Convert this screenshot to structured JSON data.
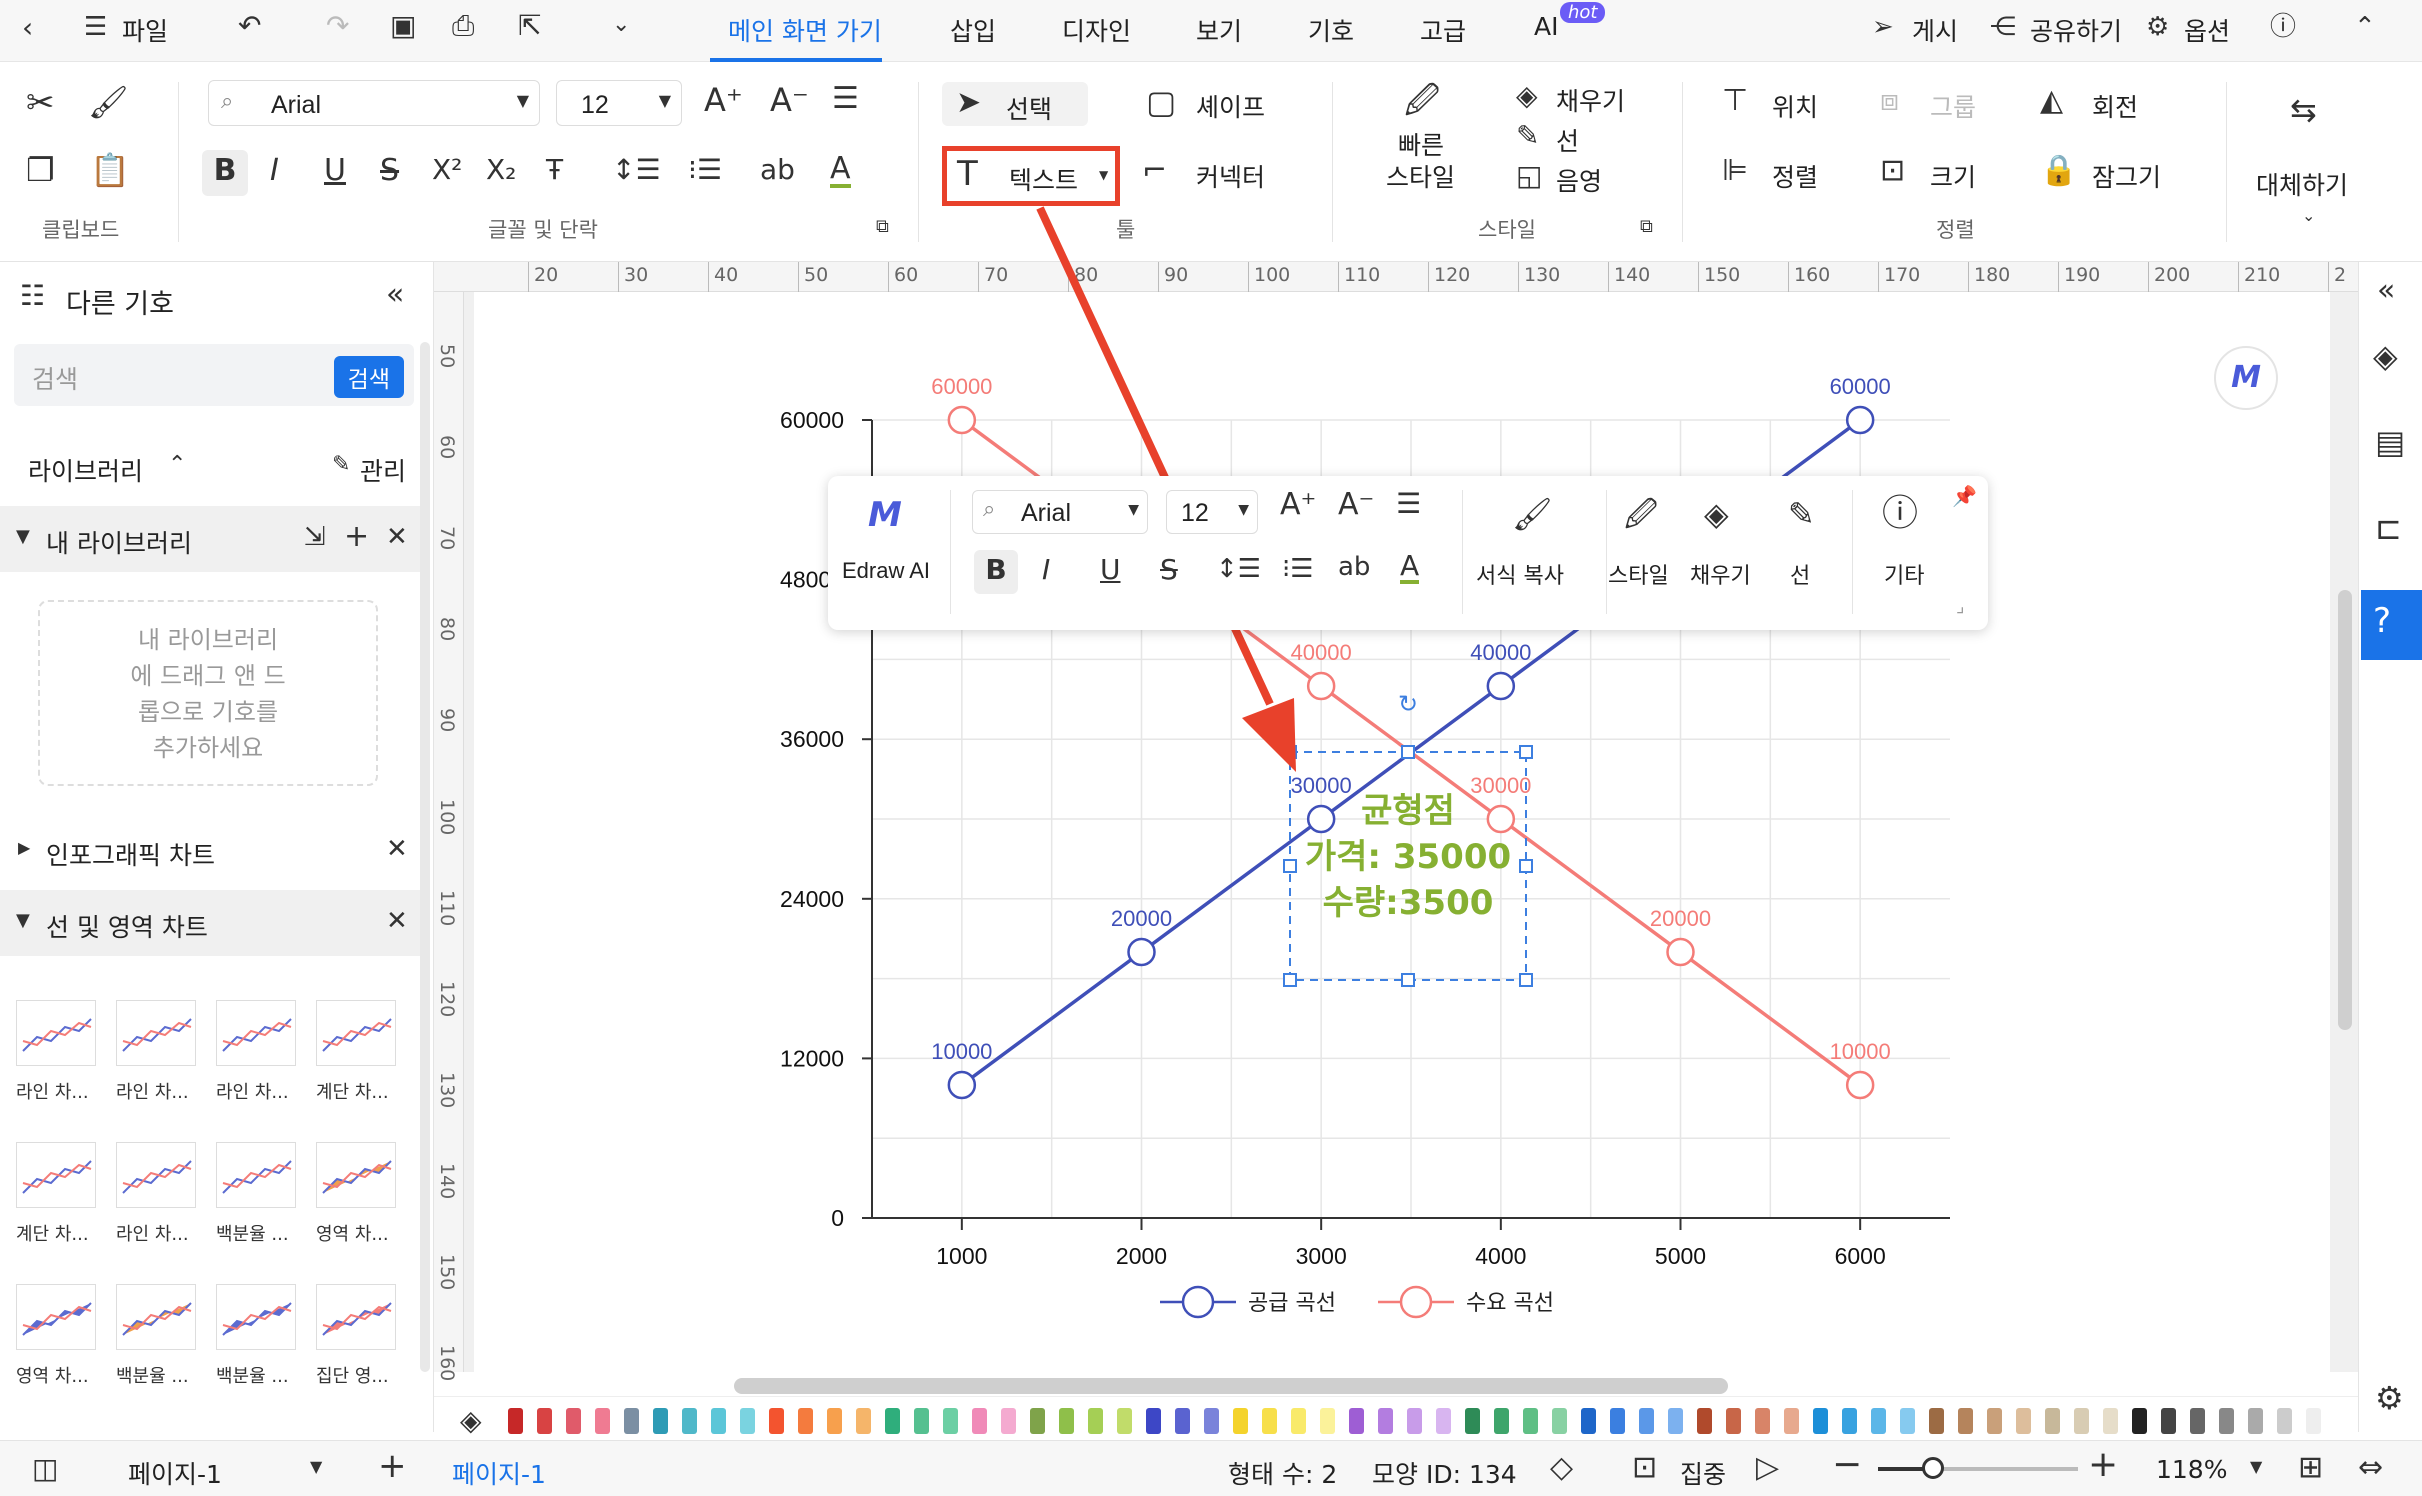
{
  "menubar": {
    "file": "파일",
    "tabs": [
      "메인 화면 가기",
      "삽입",
      "디자인",
      "보기",
      "기호",
      "고급",
      "AI"
    ],
    "hot_badge": "hot",
    "publish": "게시",
    "share": "공유하기",
    "options": "옵션"
  },
  "ribbon": {
    "font_name": "Arial",
    "font_size": "12",
    "select": "선택",
    "shape": "셰이프",
    "text": "텍스트",
    "connector": "커넥터",
    "quick_style_1": "빠른",
    "quick_style_2": "스타일",
    "fill": "채우기",
    "line": "선",
    "shadow": "음영",
    "position": "위치",
    "group": "그룹",
    "rotate": "회전",
    "align": "정렬",
    "size": "크기",
    "lock": "잠그기",
    "replace": "대체하기",
    "groups": {
      "clipboard": "클립보드",
      "font_paragraph": "글꼴 및 단락",
      "tools": "툴",
      "style": "스타일",
      "arrange": "정렬"
    }
  },
  "sidebar": {
    "title": "다른 기호",
    "search_placeholder": "검색",
    "search_button": "검색",
    "library": "라이브러리",
    "manage": "관리",
    "my_library": "내 라이브러리",
    "drop_hint": [
      "내 라이브러리",
      "에 드래그 앤 드",
      "롭으로 기호를",
      "추가하세요"
    ],
    "infographic": "인포그래픽 차트",
    "line_area": "선 및 영역 차트",
    "thumbs": [
      "라인 차...",
      "라인 차...",
      "라인 차...",
      "계단 차...",
      "계단 차...",
      "라인 차...",
      "백분율 ...",
      "영역 차...",
      "영역 차...",
      "백분율 ...",
      "백분율 ...",
      "집단 영..."
    ]
  },
  "ruler": {
    "h": [
      "20",
      "30",
      "40",
      "50",
      "60",
      "70",
      "80",
      "90",
      "100",
      "110",
      "120",
      "130",
      "140",
      "150",
      "160",
      "170",
      "180",
      "190",
      "200",
      "210",
      "2"
    ],
    "v": [
      "50",
      "60",
      "70",
      "80",
      "90",
      "100",
      "110",
      "120",
      "130",
      "140",
      "150",
      "160"
    ]
  },
  "floating_toolbar": {
    "ai": "Edraw AI",
    "font": "Arial",
    "size": "12",
    "format_copy": "서식 복사",
    "style": "스타일",
    "fill": "채우기",
    "line": "선",
    "more": "기타"
  },
  "textbox": {
    "line1": "균형점",
    "line2": "가격: 35000",
    "line3": "수량:3500"
  },
  "chart_data": {
    "type": "line",
    "x": [
      1000,
      2000,
      3000,
      4000,
      5000,
      6000
    ],
    "xlim": [
      500,
      6500
    ],
    "ylim": [
      0,
      60000
    ],
    "y_ticks": [
      "60000",
      "48000",
      "36000",
      "24000",
      "12000",
      "0"
    ],
    "x_ticks": [
      "1000",
      "2000",
      "3000",
      "4000",
      "5000",
      "6000"
    ],
    "legend_position": "bottom",
    "series": [
      {
        "name": "공급 곡선",
        "color": "#3f4fb8",
        "values": [
          10000,
          20000,
          30000,
          40000,
          50000,
          60000
        ],
        "labels": [
          "10000",
          "20000",
          "30000",
          "40000",
          "",
          "60000"
        ]
      },
      {
        "name": "수요 곡선",
        "color": "#f47c78",
        "values": [
          60000,
          50000,
          40000,
          30000,
          20000,
          10000
        ],
        "labels": [
          "60000",
          "",
          "40000",
          "30000",
          "20000",
          "10000"
        ]
      }
    ]
  },
  "status": {
    "page_tab": "페이지-1",
    "page_current": "페이지-1",
    "shape_count": "형태 수: 2",
    "shape_id": "모양 ID: 134",
    "focus": "집중",
    "zoom": "118%"
  },
  "colors": {
    "accent": "#1a73e8",
    "highlight_box": "#e8412b",
    "textbox_green": "#86b032"
  }
}
